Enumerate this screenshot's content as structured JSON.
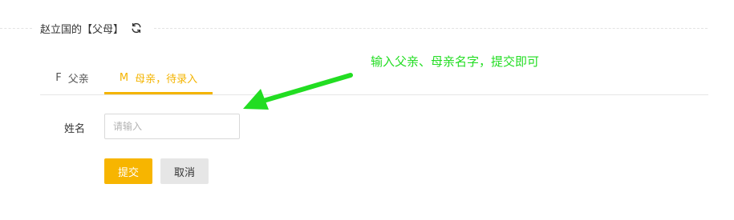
{
  "section": {
    "title": "赵立国的【父母】",
    "refresh_icon": "refresh-icon"
  },
  "tabs": [
    {
      "letter": "F",
      "label": "父亲",
      "active": false
    },
    {
      "letter": "M",
      "label": "母亲，待录入",
      "active": true
    }
  ],
  "annotation": {
    "text": "输入父亲、母亲名字，提交即可",
    "color": "#22dd22"
  },
  "form": {
    "name_label": "姓名",
    "name_value": "",
    "name_placeholder": "请输入",
    "submit_label": "提交",
    "cancel_label": "取消"
  },
  "colors": {
    "accent": "#f7b500",
    "tab_active": "#f4b400",
    "annotation_arrow": "#22dd22"
  }
}
